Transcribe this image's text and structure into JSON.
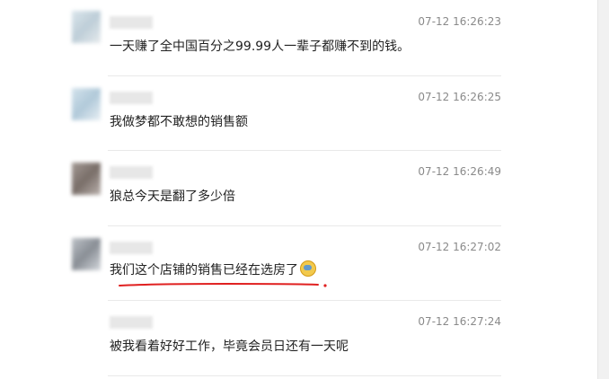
{
  "messages": [
    {
      "time": "07-12 16:26:23",
      "text": "一天赚了全中国百分之99.99人一辈子都赚不到的钱。"
    },
    {
      "time": "07-12 16:26:25",
      "text": "我做梦都不敢想的销售额"
    },
    {
      "time": "07-12 16:26:49",
      "text": "狼总今天是翻了多少倍"
    },
    {
      "time": "07-12 16:27:02",
      "text": "我们这个店铺的销售已经在选房了"
    },
    {
      "time": "07-12 16:27:24",
      "text": "被我看着好好工作，毕竟会员日还有一天呢"
    }
  ],
  "colors": {
    "annotation": "#e02020",
    "time": "#8a8a8a",
    "text": "#222222"
  },
  "icons": {
    "emoji": "laughing-emoji-icon"
  }
}
